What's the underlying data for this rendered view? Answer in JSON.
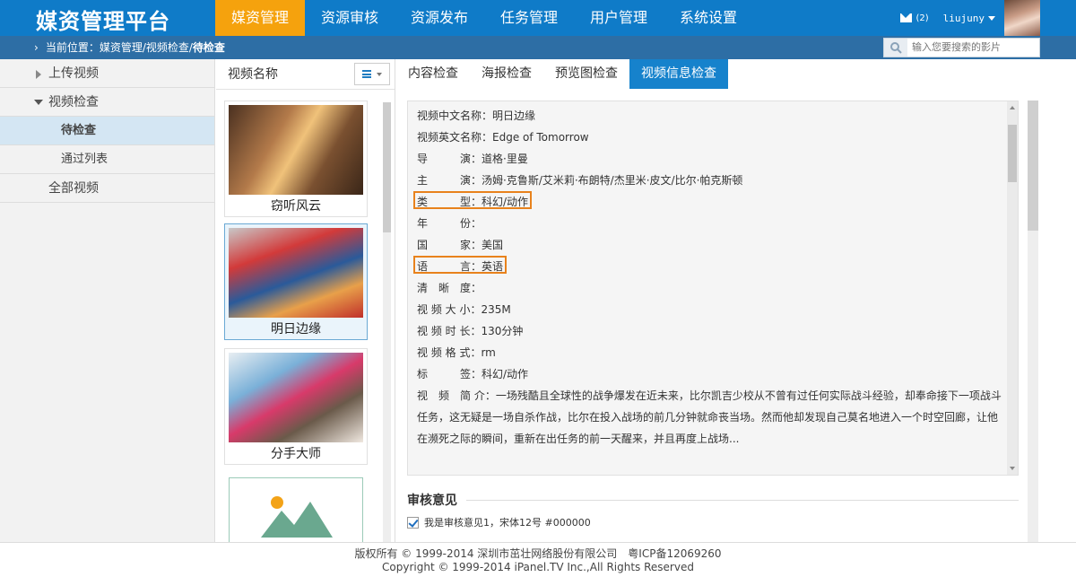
{
  "app": {
    "title": "媒资管理平台"
  },
  "nav": [
    "媒资管理",
    "资源审核",
    "资源发布",
    "任务管理",
    "用户管理",
    "系统设置"
  ],
  "user": {
    "mail_count": "(2)",
    "name": "liujuny"
  },
  "breadcrumb": {
    "prefix": "当前位置：媒资管理/视频检查/",
    "current": "待检查"
  },
  "search": {
    "placeholder": "输入您要搜索的影片"
  },
  "sidebar": {
    "items": [
      {
        "label": "上传视频"
      },
      {
        "label": "视频检查"
      },
      {
        "label": "待检查"
      },
      {
        "label": "通过列表"
      },
      {
        "label": "全部视频"
      }
    ]
  },
  "videolist": {
    "header": "视频名称",
    "items": [
      {
        "title": "窃听风云"
      },
      {
        "title": "明日边缘"
      },
      {
        "title": "分手大师"
      }
    ]
  },
  "tabs": [
    "内容检查",
    "海报检查",
    "预览图检查",
    "视频信息检查"
  ],
  "info": {
    "lines": [
      "视频中文名称：明日边缘",
      "视频英文名称：Edge of Tomorrow",
      "导　　　演：道格·里曼",
      "主　　　演：汤姆·克鲁斯/艾米莉·布朗特/杰里米·皮文/比尔·帕克斯顿",
      "类　　　型：科幻/动作",
      "年　　　份：",
      "国　　　家：美国",
      "语　　　言：英语",
      "清　晰　度：",
      "视 频 大 小：235M",
      "视 频 时 长：130分钟",
      "视 频 格 式：rm",
      "标　　　签：科幻/动作",
      "视　频　简 介：一场残酷且全球性的战争爆发在近未来，比尔凯吉少校从不曾有过任何实际战斗经验，却奉命接下一项战斗",
      "任务，这无疑是一场自杀作战，比尔在投入战场的前几分钟就命丧当场。然而他却发现自己莫名地进入一个时空回廊，让他",
      "在濒死之际的瞬间，重新在出任务的前一天醒来，并且再度上战场..."
    ]
  },
  "review": {
    "title": "审核意见",
    "option1": "我是审核意见1，宋体12号 #000000"
  },
  "footer": {
    "line1": "版权所有 © 1999-2014 深圳市茁壮网络股份有限公司　粤ICP备12069260",
    "line2": "Copyright © 1999-2014 iPanel.TV Inc.,All Rights Reserved"
  },
  "colors": {
    "accent": "#0f7bc8",
    "active_nav": "#f5a20d",
    "highlight_box": "#e8821c"
  }
}
